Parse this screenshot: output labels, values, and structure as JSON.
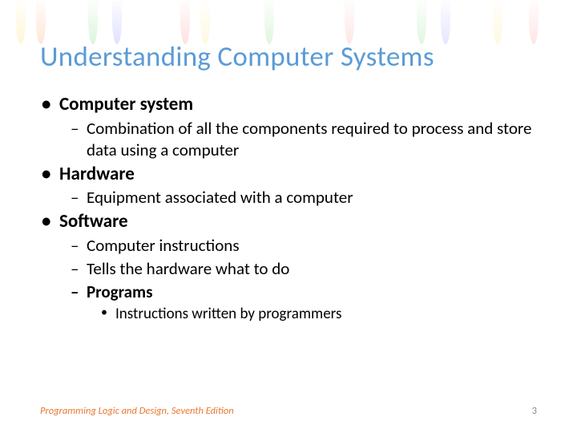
{
  "title": "Understanding Computer Systems",
  "bullets": {
    "b0": "Computer system",
    "b0s0": "Combination of all the components required to process and store data using a computer",
    "b1": "Hardware",
    "b1s0": "Equipment associated with a computer",
    "b2": "Software",
    "b2s0": "Computer instructions",
    "b2s1": "Tells the hardware what to do",
    "b2s2": "Programs",
    "b2s2s0": "Instructions written by programmers"
  },
  "footer": {
    "text": "Programming Logic and Design, Seventh Edition",
    "page": "3"
  }
}
